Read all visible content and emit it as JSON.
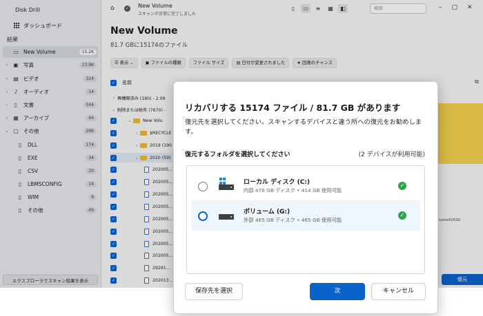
{
  "app": {
    "name": "Disk Drill",
    "dashboard_label": "ダッシュボード",
    "results_label": "結果",
    "export_button_label": "エクスプローラでスキャン結果を表示"
  },
  "sidebar": {
    "items": [
      {
        "label": "New Volume",
        "count": "15.2K",
        "icon": "drive-icon",
        "active": true
      },
      {
        "label": "写真",
        "count": "13.9K",
        "icon": "image-icon"
      },
      {
        "label": "ビデオ",
        "count": "324",
        "icon": "video-icon"
      },
      {
        "label": "オーディオ",
        "count": "14",
        "icon": "music-icon"
      },
      {
        "label": "文書",
        "count": "544",
        "icon": "document-icon"
      },
      {
        "label": "アーカイブ",
        "count": "64",
        "icon": "archive-icon"
      },
      {
        "label": "その他",
        "count": "296",
        "icon": "other-icon"
      }
    ],
    "sub_items": [
      {
        "label": "DLL",
        "count": "174"
      },
      {
        "label": "EXE",
        "count": "34"
      },
      {
        "label": "CSV",
        "count": "20"
      },
      {
        "label": "LBMSCONFIG",
        "count": "14"
      },
      {
        "label": "WIM",
        "count": "9"
      },
      {
        "label": "その他",
        "count": "49"
      }
    ]
  },
  "topbar": {
    "title": "New Volume",
    "subtitle": "スキャンが正常に完了しました",
    "search_placeholder": "検索"
  },
  "volume": {
    "title": "New Volume",
    "subtitle": "81.7 GBに15174のファイル"
  },
  "filters": {
    "view": "表示",
    "file_type": "ファイルの種類",
    "file_size": "ファイル サイズ",
    "date_modified": "日付が変更されました",
    "recovery_chance": "回復のチャンス"
  },
  "table": {
    "name_header": "名前",
    "rows": [
      {
        "text": "再構築済み (180) - 2.09"
      },
      {
        "text": "削除または紛失 (7670) -"
      },
      {
        "text": "New Volu"
      },
      {
        "text": "$RECYCLE"
      },
      {
        "text": "2019 (190"
      },
      {
        "text": "2020 (59)"
      },
      {
        "text": "202005..."
      },
      {
        "text": "202005..."
      },
      {
        "text": "202005..."
      },
      {
        "text": "202005..."
      },
      {
        "text": "202005..."
      },
      {
        "text": "202005..."
      },
      {
        "text": "202005..."
      },
      {
        "text": "202005..."
      },
      {
        "text": "29291..."
      },
      {
        "text": "202013..."
      }
    ]
  },
  "preview": {
    "path_text": "lume¥2020"
  },
  "recover_button_label": "復元",
  "dialog": {
    "title": "リカバリする 15174 ファイル / 81.7 GB があります",
    "description": "復元先を選択してください。スキャンするデバイスと違う所への復元をお勧めします。",
    "section_label": "復元するフォルダを選択してください",
    "available_label": "(2 デバイスが利用可能)",
    "drives": [
      {
        "name": "ローカル ディスク (C:)",
        "info": "内部 476 GB ディスク • 414 GB 使用可能",
        "selected": false
      },
      {
        "name": "ボリューム (G:)",
        "info": "外部 465 GB ディスク • 465 GB 使用可能",
        "selected": true
      }
    ],
    "browse_label": "保存先を選択",
    "next_label": "次",
    "cancel_label": "キャンセル"
  }
}
